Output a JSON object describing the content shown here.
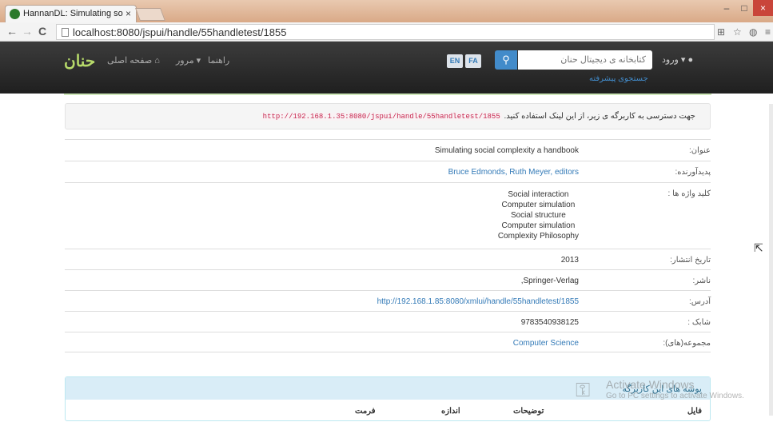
{
  "browser": {
    "tab_title": "HannanDL: Simulating so",
    "tab_close": "×",
    "window_controls": {
      "minimize": "–",
      "maximize": "□",
      "close": "×"
    },
    "url": "localhost:8080/jspui/handle/55handletest/1855",
    "nav": {
      "back": "←",
      "forward": "→",
      "reload": "C"
    }
  },
  "navbar": {
    "logo_text": "ﺣﻨﺎن",
    "home": "صفحه اصلی",
    "browse": "مرور ▾",
    "help": "راهنما",
    "lang_en": "EN",
    "lang_fa": "FA",
    "search_icon": "🔍",
    "search_placeholder": "کتابخانه ی دیجیتال حنان",
    "advanced_search": "جستجوی پیشرفته",
    "login": "ورود ▾"
  },
  "notice": {
    "text": "جهت دسترسی به کاربرگه ی زیر، از این لینک استفاده کنید.",
    "link": "http://192.168.1.35:8080/jspui/handle/55handletest/1855"
  },
  "metadata": {
    "title": {
      "label": "عنوان:",
      "value": "Simulating social complexity a handbook"
    },
    "creators": {
      "label": "پدیدآورنده:",
      "value": "Bruce Edmonds, Ruth Meyer, editors"
    },
    "keywords": {
      "label": "کلید واژه ها :",
      "values": [
        "Social interaction",
        "Computer simulation",
        "Social structure",
        "Computer simulation",
        "Complexity Philosophy"
      ]
    },
    "date": {
      "label": "تاریخ انتشار:",
      "value": "2013"
    },
    "publisher": {
      "label": "ناشر:",
      "value": ",Springer-Verlag"
    },
    "uri": {
      "label": "آدرس:",
      "value": "http://192.168.1.85:8080/xmlui/handle/55handletest/1855"
    },
    "isbn": {
      "label": "شابک :",
      "value": "9783540938125"
    },
    "collections": {
      "label": "مجموعه(های):",
      "value": "Computer Science"
    }
  },
  "files": {
    "heading": "پوشه های این کاربرگه",
    "columns": {
      "file": "فایل",
      "description": "توضیحات",
      "size": "اندازه",
      "format": "فرمت"
    }
  },
  "watermark": {
    "line1": "Activate Windows",
    "line2": "Go to PC settings to activate Windows."
  }
}
